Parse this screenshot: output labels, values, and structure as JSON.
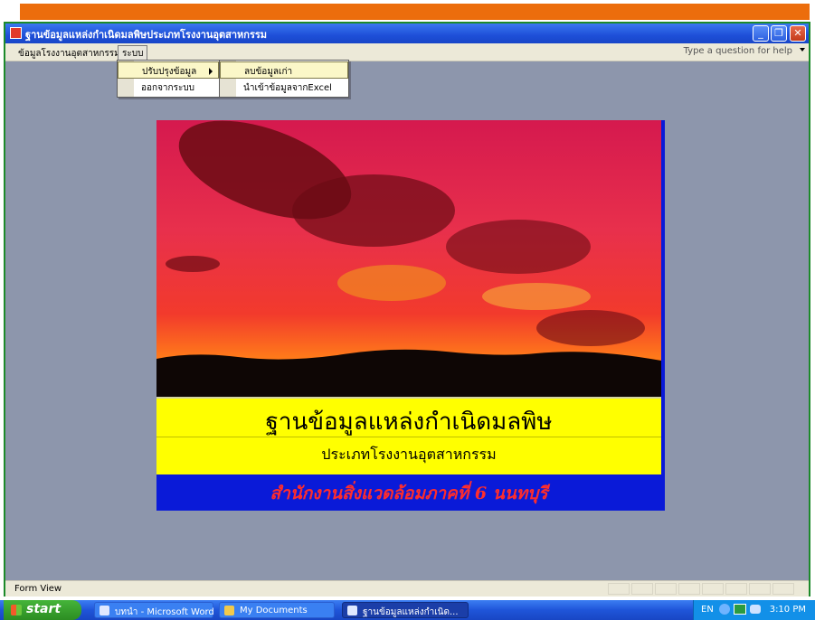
{
  "window": {
    "title": "ฐานข้อมูลแหล่งกำเนิดมลพิษประเภทโรงงานอุตสาหกรรม",
    "minimize_glyph": "_",
    "restore_glyph": "❐",
    "close_glyph": "✕"
  },
  "menubar": {
    "items": [
      "ข้อมูลโรงงานอุตสาหกรรม",
      "ระบบ"
    ],
    "help_placeholder": "Type a question for help"
  },
  "menu_system": {
    "items": [
      "ปรับปรุงข้อมูล",
      "ออกจากระบบ"
    ]
  },
  "submenu_update": {
    "items": [
      "ลบข้อมูลเก่า",
      "นำเข้าข้อมูลจากExcel"
    ]
  },
  "splash": {
    "title": "ฐานข้อมูลแหล่งกำเนิดมลพิษ",
    "subtitle": "ประเภทโรงงานอุตสาหกรรม",
    "office": "สำนักงานสิ่งแวดล้อมภาคที่ 6 นนทบุรี"
  },
  "statusbar": {
    "text": "Form View"
  },
  "taskbar": {
    "start_label": "start",
    "tasks": [
      {
        "label": "บทนำ - Microsoft Word",
        "icon": "word-icon"
      },
      {
        "label": "My Documents",
        "icon": "folder-icon"
      },
      {
        "label": "ฐานข้อมูลแหล่งกำเนิด...",
        "icon": "access-icon"
      }
    ],
    "tray": {
      "language": "EN",
      "clock": "3:10 PM"
    }
  },
  "colors": {
    "accent_orange": "#ec6d0c",
    "client_bg": "#8d96ac",
    "splash_yellow": "#ffff00",
    "splash_blue": "#0a1ad8",
    "office_text": "#ff2d2d"
  }
}
